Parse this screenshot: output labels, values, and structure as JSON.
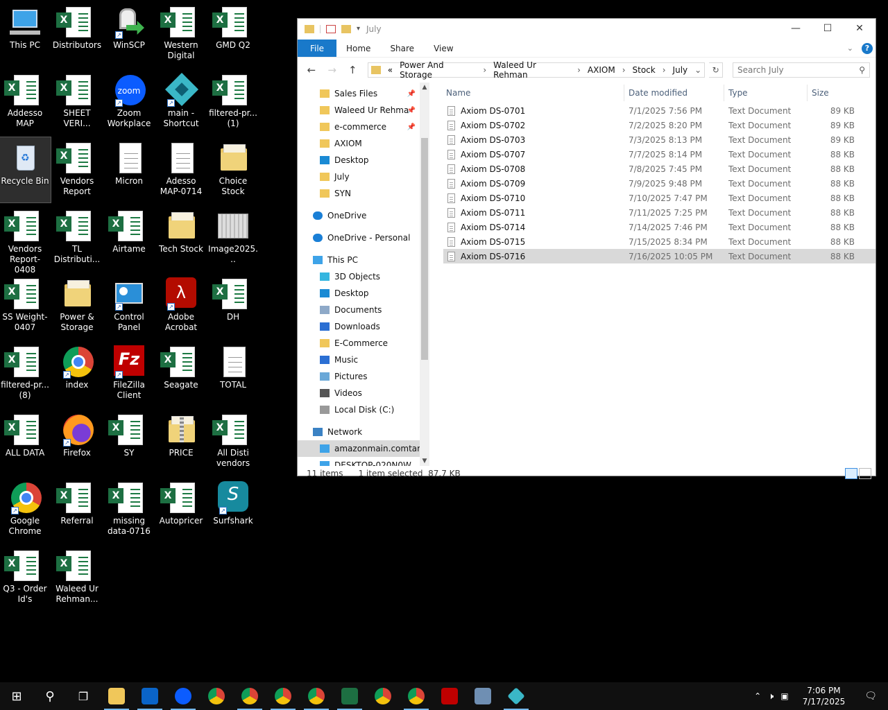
{
  "desktop": {
    "icons": [
      {
        "label": "This PC",
        "type": "pc"
      },
      {
        "label": "Distributors",
        "type": "excel"
      },
      {
        "label": "WinSCP",
        "type": "winscp"
      },
      {
        "label": "Western Digital",
        "type": "excel"
      },
      {
        "label": "GMD Q2",
        "type": "excel"
      },
      {
        "label": "Addesso MAP",
        "type": "excel"
      },
      {
        "label": "SHEET VERI...",
        "type": "excel"
      },
      {
        "label": "Zoom Workplace",
        "type": "zoom"
      },
      {
        "label": "main - Shortcut",
        "type": "main"
      },
      {
        "label": "filtered-pr... (1)",
        "type": "excel"
      },
      {
        "label": "Recycle Bin",
        "type": "recycle"
      },
      {
        "label": "Vendors Report",
        "type": "excel"
      },
      {
        "label": "Micron",
        "type": "doc"
      },
      {
        "label": "Adesso MAP-0714",
        "type": "doc"
      },
      {
        "label": "Choice Stock",
        "type": "folder"
      },
      {
        "label": "Vendors Report-0408",
        "type": "excel"
      },
      {
        "label": "TL Distributi...",
        "type": "excel"
      },
      {
        "label": "Airtame",
        "type": "excel"
      },
      {
        "label": "Tech Stock",
        "type": "folder"
      },
      {
        "label": "Image2025...",
        "type": "image"
      },
      {
        "label": "SS Weight-0407",
        "type": "excel"
      },
      {
        "label": "Power & Storage",
        "type": "folder"
      },
      {
        "label": "Control Panel",
        "type": "control"
      },
      {
        "label": "Adobe Acrobat",
        "type": "acrobat"
      },
      {
        "label": "DH",
        "type": "excel"
      },
      {
        "label": "filtered-pr... (8)",
        "type": "excel"
      },
      {
        "label": "index",
        "type": "chrome"
      },
      {
        "label": "FileZilla Client",
        "type": "filezilla"
      },
      {
        "label": "Seagate",
        "type": "excel"
      },
      {
        "label": "TOTAL",
        "type": "doc"
      },
      {
        "label": "ALL DATA",
        "type": "excel"
      },
      {
        "label": "Firefox",
        "type": "firefox"
      },
      {
        "label": "SY",
        "type": "excel"
      },
      {
        "label": "PRICE",
        "type": "zip"
      },
      {
        "label": "All Disti vendors",
        "type": "excel"
      },
      {
        "label": "Google Chrome",
        "type": "chrome"
      },
      {
        "label": "Referral",
        "type": "excel"
      },
      {
        "label": "missing data-0716",
        "type": "excel"
      },
      {
        "label": "Autopricer",
        "type": "excel"
      },
      {
        "label": "Surfshark",
        "type": "surfshark"
      },
      {
        "label": "Q3 - Order Id's",
        "type": "excel"
      },
      {
        "label": "Waleed Ur Rehman...",
        "type": "excel"
      }
    ]
  },
  "explorer": {
    "title": "July",
    "ribbon": {
      "file": "File",
      "home": "Home",
      "share": "Share",
      "view": "View"
    },
    "breadcrumb": [
      "Power And Storage",
      "Waleed Ur Rehman",
      "AXIOM",
      "Stock",
      "July"
    ],
    "breadcrumb_prefix": "«",
    "search_placeholder": "Search July",
    "nav": {
      "quick": [
        {
          "label": "Sales Files",
          "pinned": true
        },
        {
          "label": "Waleed Ur Rehma",
          "pinned": true
        },
        {
          "label": "e-commerce",
          "pinned": true
        },
        {
          "label": "AXIOM",
          "pinned": false
        },
        {
          "label": "Desktop",
          "pinned": false
        },
        {
          "label": "July",
          "pinned": false
        },
        {
          "label": "SYN",
          "pinned": false
        }
      ],
      "onedrive": "OneDrive",
      "onedrive_personal": "OneDrive - Personal",
      "this_pc": "This PC",
      "pc_items": [
        "3D Objects",
        "Desktop",
        "Documents",
        "Downloads",
        "E-Commerce",
        "Music",
        "Pictures",
        "Videos",
        "Local Disk (C:)"
      ],
      "network": "Network",
      "network_items": [
        "amazonmain.comtar",
        "DESKTOP-020N0W"
      ]
    },
    "columns": {
      "name": "Name",
      "date": "Date modified",
      "type": "Type",
      "size": "Size"
    },
    "files": [
      {
        "name": "Axiom DS-0701",
        "date": "7/1/2025 7:56 PM",
        "type": "Text Document",
        "size": "89 KB"
      },
      {
        "name": "Axiom DS-0702",
        "date": "7/2/2025 8:20 PM",
        "type": "Text Document",
        "size": "89 KB"
      },
      {
        "name": "Axiom DS-0703",
        "date": "7/3/2025 8:13 PM",
        "type": "Text Document",
        "size": "89 KB"
      },
      {
        "name": "Axiom DS-0707",
        "date": "7/7/2025 8:14 PM",
        "type": "Text Document",
        "size": "88 KB"
      },
      {
        "name": "Axiom DS-0708",
        "date": "7/8/2025 7:45 PM",
        "type": "Text Document",
        "size": "88 KB"
      },
      {
        "name": "Axiom DS-0709",
        "date": "7/9/2025 9:48 PM",
        "type": "Text Document",
        "size": "88 KB"
      },
      {
        "name": "Axiom DS-0710",
        "date": "7/10/2025 7:47 PM",
        "type": "Text Document",
        "size": "88 KB"
      },
      {
        "name": "Axiom DS-0711",
        "date": "7/11/2025 7:25 PM",
        "type": "Text Document",
        "size": "88 KB"
      },
      {
        "name": "Axiom DS-0714",
        "date": "7/14/2025 7:46 PM",
        "type": "Text Document",
        "size": "88 KB"
      },
      {
        "name": "Axiom DS-0715",
        "date": "7/15/2025 8:34 PM",
        "type": "Text Document",
        "size": "88 KB"
      },
      {
        "name": "Axiom DS-0716",
        "date": "7/16/2025 10:05 PM",
        "type": "Text Document",
        "size": "88 KB",
        "selected": true
      }
    ],
    "status": {
      "count": "11 items",
      "selection": "1 item selected  87.7 KB"
    }
  },
  "taskbar": {
    "time": "7:06 PM",
    "date": "7/17/2025",
    "apps": [
      "start",
      "search",
      "task-view",
      "file-explorer",
      "outlook",
      "zoom",
      "chrome",
      "chrome",
      "chrome",
      "chrome",
      "excel",
      "chrome",
      "chrome",
      "filezilla",
      "calculator",
      "main"
    ]
  },
  "colors": {
    "accent": "#1979ca",
    "selection": "#d9d9d9",
    "excel": "#1d6f42"
  }
}
